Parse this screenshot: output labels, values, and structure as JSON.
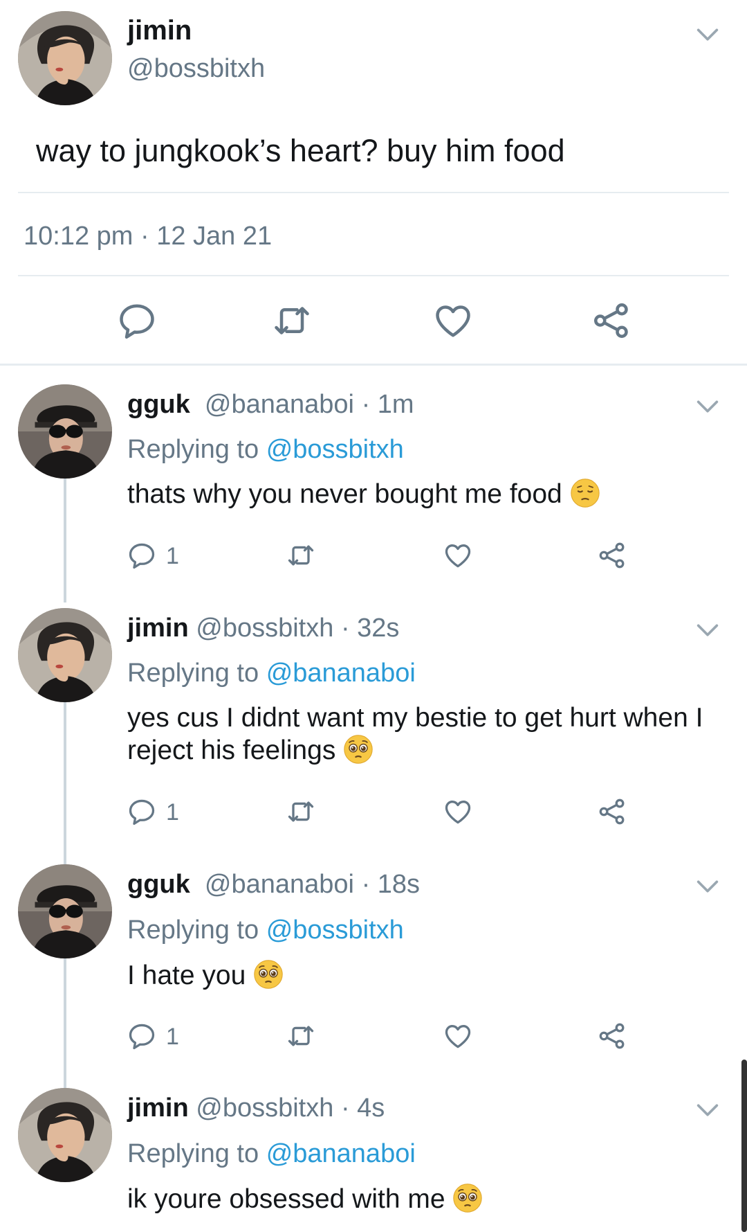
{
  "main_tweet": {
    "name": "jimin",
    "handle": "@bossbitxh",
    "text": "way to jungkook’s heart? buy him food",
    "timestamp": "10:12 pm · 12 Jan 21",
    "avatar_icon": "avatar-photo"
  },
  "replies": [
    {
      "name": "gguk",
      "handle": "@bananaboi",
      "time": "· 1m",
      "replying_prefix": "Replying to",
      "replying_to": "@bossbitxh",
      "text": "thats why you never bought me food",
      "emoji": "pensive-face-emoji",
      "reply_count": "1"
    },
    {
      "name": "jimin",
      "handle": "@bossbitxh",
      "time": "· 32s",
      "replying_prefix": "Replying to",
      "replying_to": "@bananaboi",
      "text": "yes cus I didnt want my bestie to get hurt when I reject his feelings",
      "emoji": "pleading-face-emoji",
      "reply_count": "1"
    },
    {
      "name": "gguk",
      "handle": "@bananaboi",
      "time": "· 18s",
      "replying_prefix": "Replying to",
      "replying_to": "@bossbitxh",
      "text": "I hate you",
      "emoji": "pleading-face-emoji",
      "reply_count": "1"
    },
    {
      "name": "jimin",
      "handle": "@bossbitxh",
      "time": "· 4s",
      "replying_prefix": "Replying to",
      "replying_to": "@bananaboi",
      "text": "ik youre obsessed with me",
      "emoji": "pleading-face-emoji",
      "reply_count": ""
    }
  ],
  "colors": {
    "accent_link": "#2a9bd7",
    "muted": "#657786",
    "divider": "#e6ecf0"
  }
}
